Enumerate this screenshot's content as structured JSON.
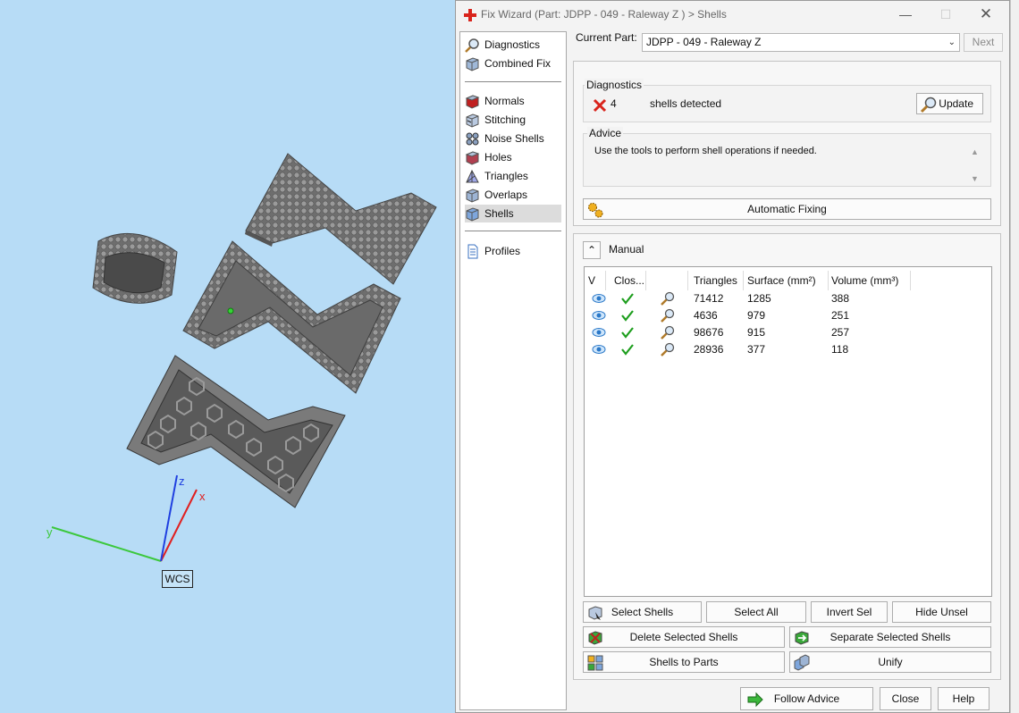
{
  "viewport": {
    "wcs_label": "WCS",
    "axes": {
      "x": "x",
      "y": "y",
      "z": "z"
    }
  },
  "dialog": {
    "title": "Fix Wizard (Part: JDPP - 049 - Raleway Z ) > Shells",
    "current_part_label": "Current Part:",
    "current_part_value": "JDPP - 049 - Raleway Z",
    "next_label": "Next"
  },
  "nav": {
    "items": [
      {
        "label": "Diagnostics",
        "icon": "magnifier-icon"
      },
      {
        "label": "Combined Fix",
        "icon": "cube-icon"
      },
      {
        "label": "Normals",
        "icon": "normals-cube-icon"
      },
      {
        "label": "Stitching",
        "icon": "stitching-cube-icon"
      },
      {
        "label": "Noise Shells",
        "icon": "noise-shells-icon"
      },
      {
        "label": "Holes",
        "icon": "holes-cube-icon"
      },
      {
        "label": "Triangles",
        "icon": "triangles-icon"
      },
      {
        "label": "Overlaps",
        "icon": "overlaps-cube-icon"
      },
      {
        "label": "Shells",
        "icon": "shells-cube-icon"
      },
      {
        "label": "Profiles",
        "icon": "document-icon"
      }
    ]
  },
  "diagnostics": {
    "title": "Diagnostics",
    "count": "4",
    "message": "shells detected",
    "update_label": "Update"
  },
  "advice": {
    "title": "Advice",
    "text": "Use the tools to perform shell operations if needed."
  },
  "automatic_fixing_label": "Automatic Fixing",
  "manual": {
    "title": "Manual",
    "columns": [
      "V",
      "Clos...",
      "",
      "Triangles",
      "Surface (mm²)",
      "Volume (mm³)"
    ],
    "rows": [
      {
        "triangles": "71412",
        "surface": "1285",
        "volume": "388"
      },
      {
        "triangles": "4636",
        "surface": "979",
        "volume": "251"
      },
      {
        "triangles": "98676",
        "surface": "915",
        "volume": "257"
      },
      {
        "triangles": "28936",
        "surface": "377",
        "volume": "118"
      }
    ]
  },
  "buttons": {
    "select_shells": "Select Shells",
    "select_all": "Select All",
    "invert_sel": "Invert Sel",
    "hide_unsel": "Hide Unsel",
    "delete_selected": "Delete Selected Shells",
    "separate_selected": "Separate Selected Shells",
    "shells_to_parts": "Shells to Parts",
    "unify": "Unify",
    "follow_advice": "Follow Advice",
    "close": "Close",
    "help": "Help"
  },
  "colors": {
    "accent_blue": "#4f8fd8",
    "error_red": "#d9241c",
    "ok_green": "#1e9e1e",
    "viewport_bg": "#b7dcf6"
  }
}
